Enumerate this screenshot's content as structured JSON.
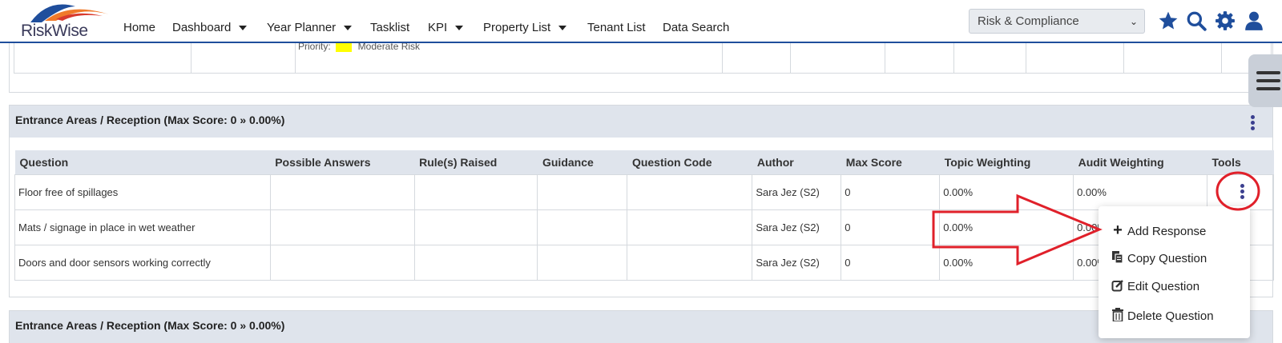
{
  "app": {
    "logo_text": "RiskWise",
    "module_selected": "Risk & Compliance"
  },
  "nav": {
    "items": [
      {
        "label": "Home"
      },
      {
        "label": "Dashboard"
      },
      {
        "label": "Year Planner"
      },
      {
        "label": "Tasklist"
      },
      {
        "label": "KPI"
      },
      {
        "label": "Property List"
      },
      {
        "label": "Tenant List"
      },
      {
        "label": "Data Search"
      }
    ],
    "icons": [
      "star-icon",
      "search-icon",
      "gear-icon",
      "user-icon"
    ]
  },
  "previous_row": {
    "priority_label": "Priority:",
    "priority_value": "Moderate Risk",
    "priority_color": "#ffff00"
  },
  "sections": [
    {
      "title": "Entrance Areas / Reception (Max Score: 0 » 0.00%)",
      "columns": [
        "Question",
        "Possible Answers",
        "Rule(s) Raised",
        "Guidance",
        "Question Code",
        "Author",
        "Max Score",
        "Topic Weighting",
        "Audit Weighting",
        "Tools"
      ],
      "rows": [
        {
          "question": "Floor free of spillages",
          "possible_answers": "",
          "rules_raised": "",
          "guidance": "",
          "question_code": "",
          "author": "Sara Jez (S2)",
          "max_score": "0",
          "topic_weighting": "0.00%",
          "audit_weighting": "0.00%"
        },
        {
          "question": "Mats / signage in place in wet weather",
          "possible_answers": "",
          "rules_raised": "",
          "guidance": "",
          "question_code": "",
          "author": "Sara Jez (S2)",
          "max_score": "0",
          "topic_weighting": "0.00%",
          "audit_weighting": "0.00%"
        },
        {
          "question": "Doors and door sensors working correctly",
          "possible_answers": "",
          "rules_raised": "",
          "guidance": "",
          "question_code": "",
          "author": "Sara Jez (S2)",
          "max_score": "0",
          "topic_weighting": "0.00%",
          "audit_weighting": "0.00%"
        }
      ]
    },
    {
      "title": "Entrance Areas / Reception (Max Score: 0 » 0.00%)"
    }
  ],
  "tools_menu": {
    "items": [
      {
        "label": "Add Response",
        "icon": "plus-icon"
      },
      {
        "label": "Copy Question",
        "icon": "copy-icon"
      },
      {
        "label": "Edit Question",
        "icon": "edit-icon"
      },
      {
        "label": "Delete Question",
        "icon": "trash-icon"
      }
    ]
  },
  "colors": {
    "brand_blue": "#1f4e9c",
    "kebab": "#3b3f8f",
    "annotation_red": "#e0202a",
    "section_header": "#dfe4ec"
  }
}
